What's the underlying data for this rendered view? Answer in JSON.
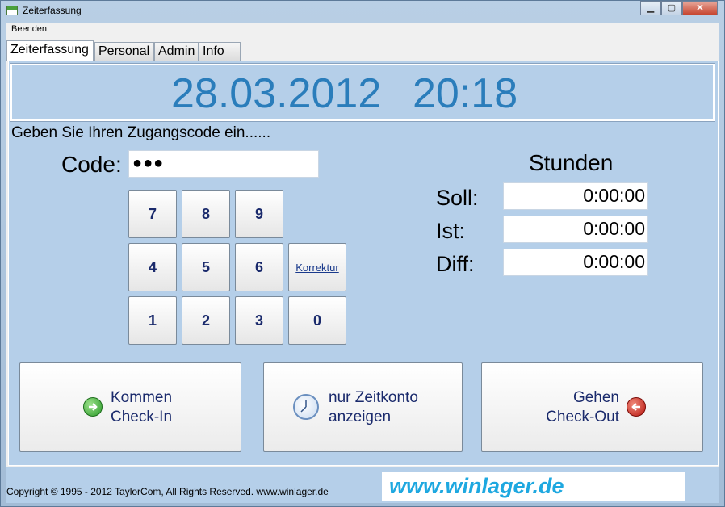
{
  "window": {
    "title": "Zeiterfassung"
  },
  "menu": {
    "items": [
      "Beenden"
    ]
  },
  "tabs": [
    "Zeiterfassung",
    "Personal",
    "Admin",
    "Info"
  ],
  "clock": {
    "date": "28.03.2012",
    "time": "20:18"
  },
  "prompt": "Geben Sie Ihren Zugangscode ein......",
  "code": {
    "label": "Code:",
    "value": "●●●"
  },
  "keypad": {
    "keys": [
      "7",
      "8",
      "9",
      "4",
      "5",
      "6",
      "Korrektur",
      "1",
      "2",
      "3",
      "0"
    ]
  },
  "hours": {
    "title": "Stunden",
    "rows": [
      {
        "label": "Soll:",
        "value": "0:00:00"
      },
      {
        "label": "Ist:",
        "value": "0:00:00"
      },
      {
        "label": "Diff:",
        "value": "0:00:00"
      }
    ]
  },
  "buttons": {
    "checkin": {
      "line1": "Kommen",
      "line2": "Check-In",
      "icon": "green-arrow-right-icon"
    },
    "account": {
      "line1": "nur Zeitkonto",
      "line2": "anzeigen",
      "icon": "clock-icon"
    },
    "checkout": {
      "line1": "Gehen",
      "line2": "Check-Out",
      "icon": "red-arrow-left-icon"
    }
  },
  "footer": {
    "copyright": "Copyright © 1995 - 2012  TaylorCom, All Rights Reserved.   www.winlager.de",
    "brand": "www.winlager.de"
  },
  "colors": {
    "accent": "#2a7dbb",
    "panel": "#b5cfe9",
    "brand": "#1ea8e0"
  }
}
